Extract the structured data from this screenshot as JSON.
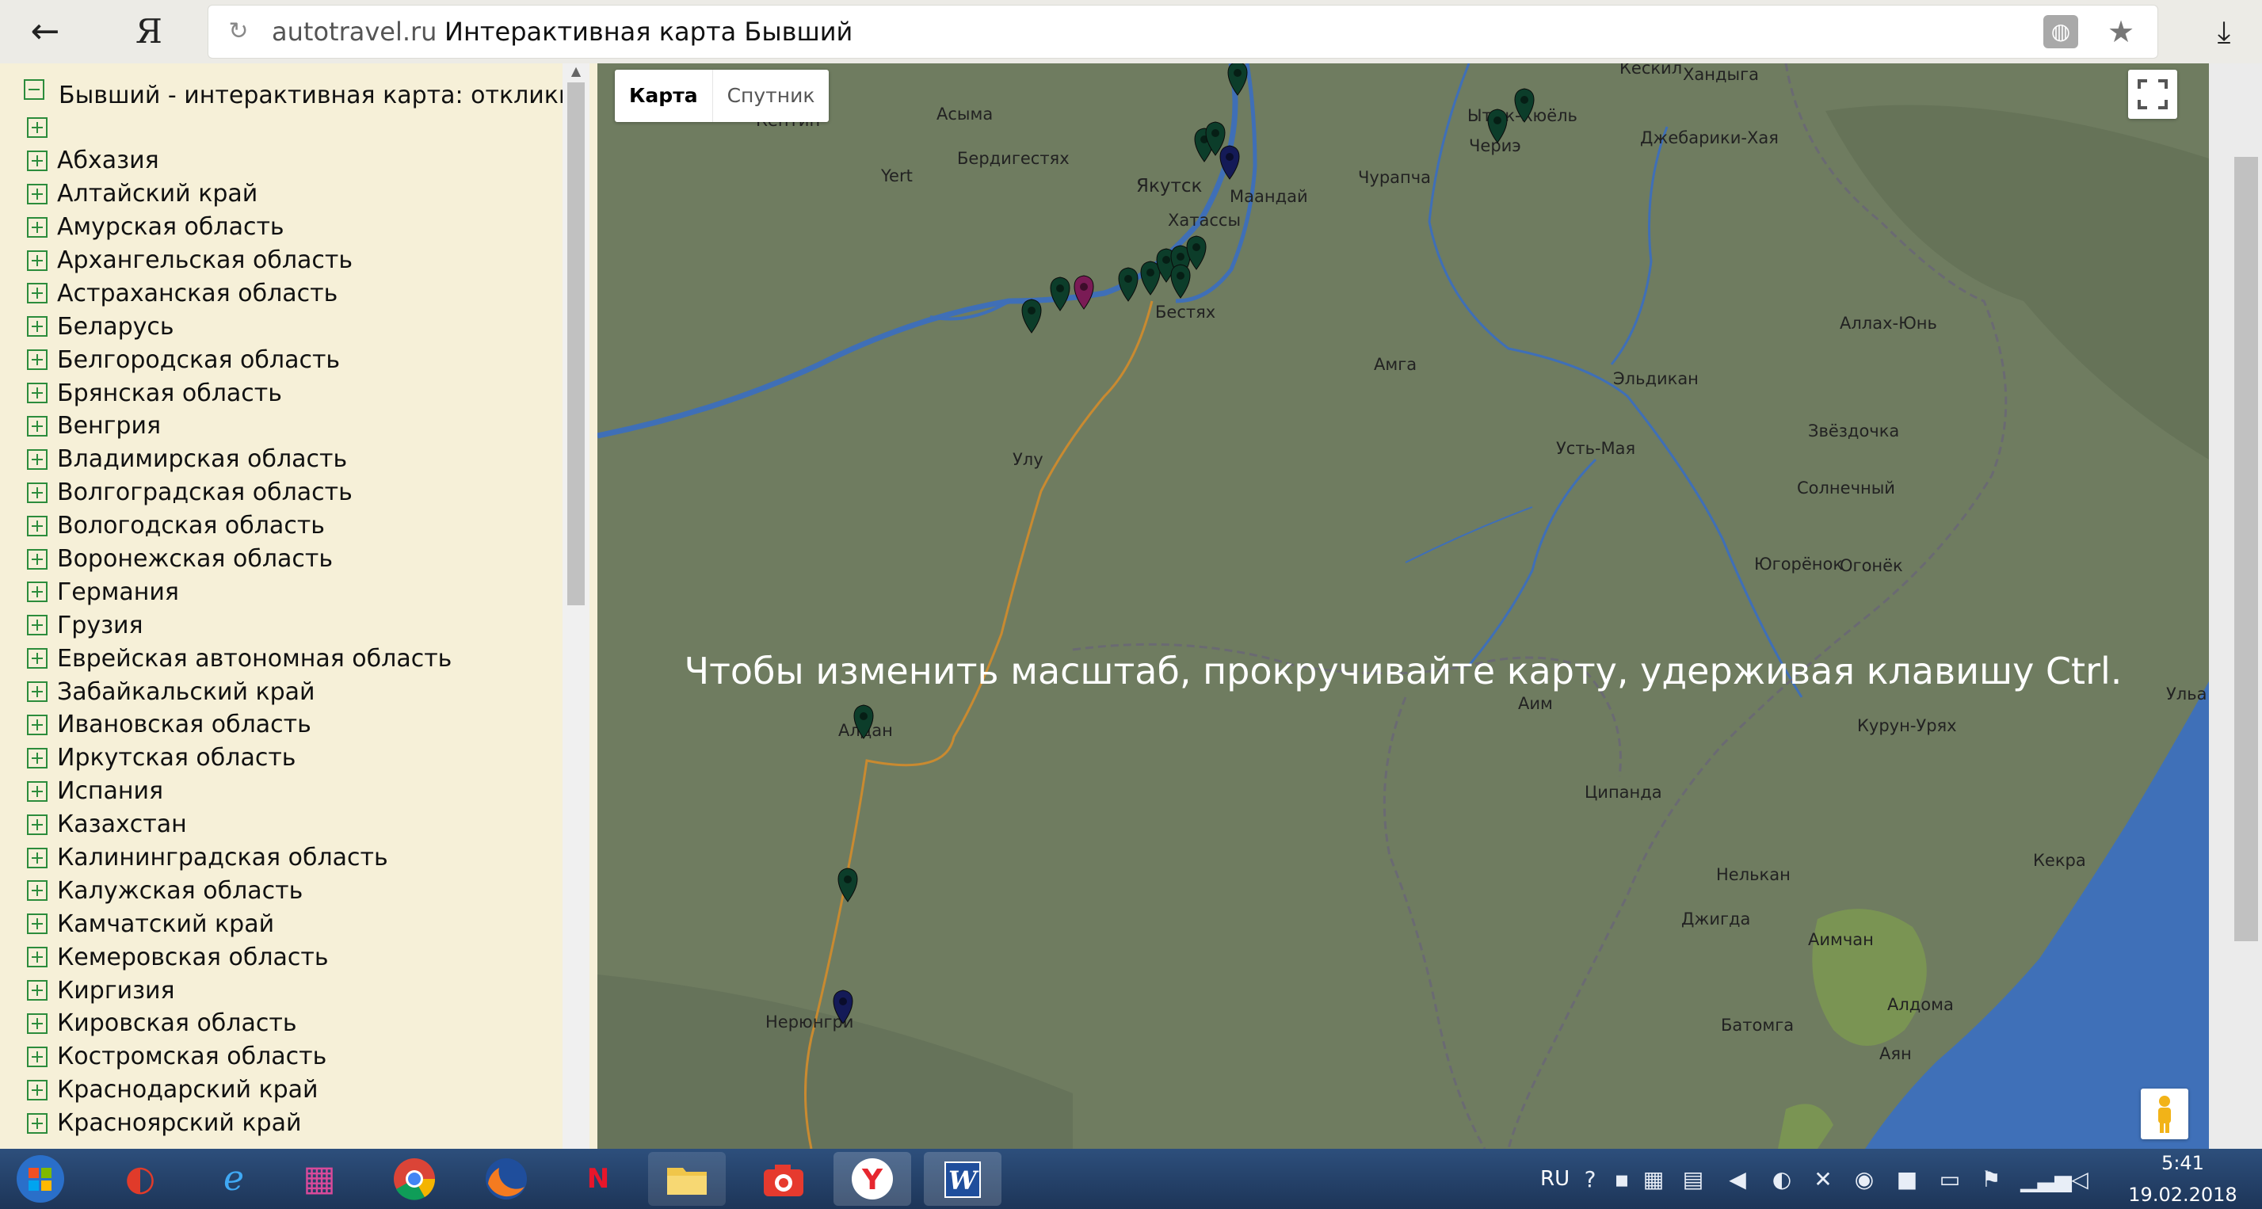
{
  "browser": {
    "back_icon": "back-arrow-icon",
    "logo": "Я",
    "url_domain": "autotravel.ru",
    "page_title": "Интерактивная карта Бывший"
  },
  "sidebar": {
    "title": "Бывший - интерактивная карта: отклики",
    "items": [
      {
        "label": ""
      },
      {
        "label": "Абхазия"
      },
      {
        "label": "Алтайский край"
      },
      {
        "label": "Амурская область"
      },
      {
        "label": "Архангельская область"
      },
      {
        "label": "Астраханская область"
      },
      {
        "label": "Беларусь"
      },
      {
        "label": "Белгородская область"
      },
      {
        "label": "Брянская область"
      },
      {
        "label": "Венгрия"
      },
      {
        "label": "Владимирская область"
      },
      {
        "label": "Волгоградская область"
      },
      {
        "label": "Вологодская область"
      },
      {
        "label": "Воронежская область"
      },
      {
        "label": "Германия"
      },
      {
        "label": "Грузия"
      },
      {
        "label": "Еврейская автономная область"
      },
      {
        "label": "Забайкальский край"
      },
      {
        "label": "Ивановская область"
      },
      {
        "label": "Иркутская область"
      },
      {
        "label": "Испания"
      },
      {
        "label": "Казахстан"
      },
      {
        "label": "Калининградская область"
      },
      {
        "label": "Калужская область"
      },
      {
        "label": "Камчатский край"
      },
      {
        "label": "Кемеровская область"
      },
      {
        "label": "Киргизия"
      },
      {
        "label": "Кировская область"
      },
      {
        "label": "Костромская область"
      },
      {
        "label": "Краснодарский край"
      },
      {
        "label": "Красноярский край"
      }
    ]
  },
  "map": {
    "type_map": "Карта",
    "type_satellite": "Спутник",
    "zoom_hint": "Чтобы изменить масштаб, прокручивайте карту, удерживая клавишу Ctrl.",
    "places": [
      "Кескил",
      "Хандыга",
      "Асыма",
      "Кептин",
      "Бердигестях",
      "Yert",
      "Якутск",
      "Маандай",
      "Хатассы",
      "Бестях",
      "Ытык-Кюёль",
      "Чурапча",
      "Чериэ",
      "Джебарики-Хая",
      "Амга",
      "Эльдикан",
      "Аллах-Юнь",
      "Улу",
      "Усть-Мая",
      "Звёздочка",
      "Солнечный",
      "Югорёнок",
      "Огонёк",
      "Алдан",
      "Аим",
      "Курун-Урях",
      "Ульа",
      "Ципанда",
      "Нелькан",
      "Кекра",
      "Джигда",
      "Аимчан",
      "Алдома",
      "Нерюнгри",
      "Батомга",
      "Аян"
    ],
    "colors": {
      "land": "#6f7c60",
      "sea": "#3f70b8",
      "marker_green": "#0c3d2a",
      "marker_navy": "#141a57",
      "marker_purple": "#7a1b55"
    }
  },
  "taskbar": {
    "lang": "RU",
    "time": "5:41",
    "date": "19.02.2018",
    "apps": [
      "start-orb",
      "ccleaner",
      "internet-explorer",
      "winrar",
      "chrome",
      "firefox",
      "nero",
      "file-explorer",
      "camera",
      "yandex-browser",
      "word"
    ]
  }
}
